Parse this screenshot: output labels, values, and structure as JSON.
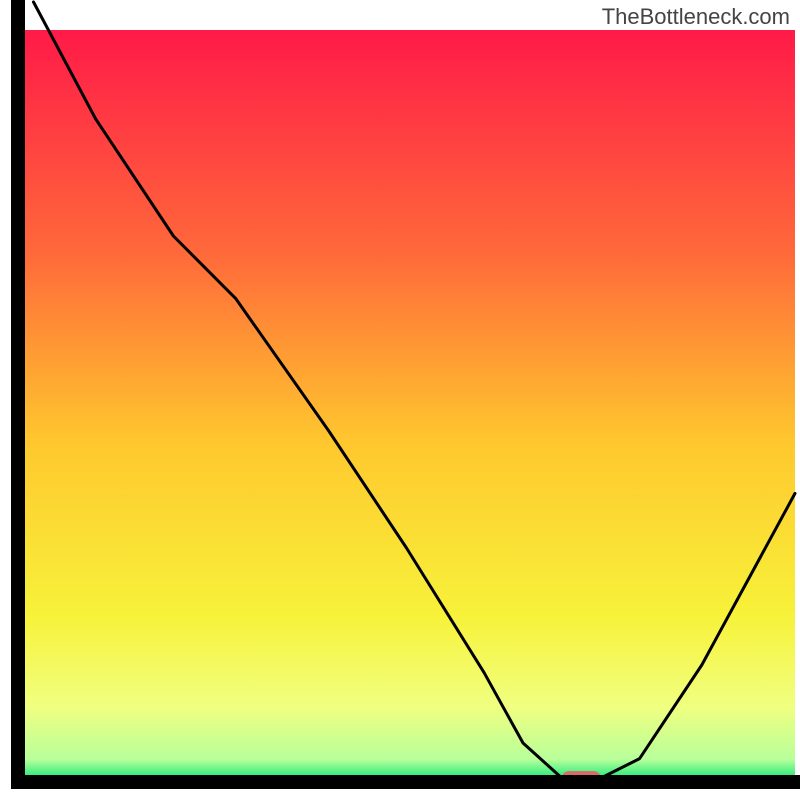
{
  "watermark": "TheBottleneck.com",
  "chart_data": {
    "type": "line",
    "title": "",
    "xlabel": "",
    "ylabel": "",
    "xlim": [
      0,
      100
    ],
    "ylim": [
      0,
      100
    ],
    "x": [
      2,
      10,
      20,
      28,
      40,
      50,
      60,
      65,
      70,
      75,
      80,
      88,
      100
    ],
    "values": [
      100,
      85,
      70,
      62,
      45,
      30,
      14,
      5,
      0.5,
      0.5,
      3,
      15,
      37
    ],
    "marker": {
      "x_range": [
        70,
        75
      ],
      "y": 0.5
    },
    "gradient_stops": [
      {
        "offset": 0.0,
        "color": "#ff1a48"
      },
      {
        "offset": 0.3,
        "color": "#ff6a3a"
      },
      {
        "offset": 0.55,
        "color": "#ffc82e"
      },
      {
        "offset": 0.78,
        "color": "#f7f23a"
      },
      {
        "offset": 0.9,
        "color": "#f0ff80"
      },
      {
        "offset": 0.97,
        "color": "#b8ff9a"
      },
      {
        "offset": 1.0,
        "color": "#00e573"
      }
    ],
    "marker_color": "#d86a6a",
    "axis_color": "#000000"
  }
}
